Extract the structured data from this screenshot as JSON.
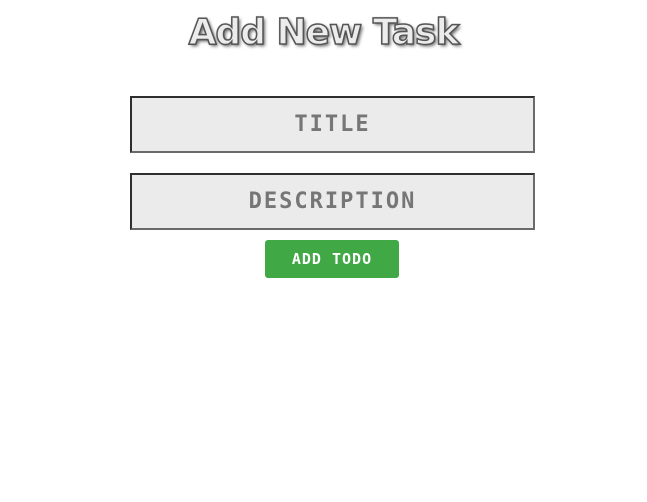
{
  "header": {
    "title": "Add New Task"
  },
  "form": {
    "title_field": {
      "value": "",
      "placeholder": "TITLE"
    },
    "description_field": {
      "value": "",
      "placeholder": "DESCRIPTION"
    },
    "submit_label": "ADD TODO"
  },
  "colors": {
    "button_bg": "#40a945",
    "field_bg": "#ebebeb"
  }
}
